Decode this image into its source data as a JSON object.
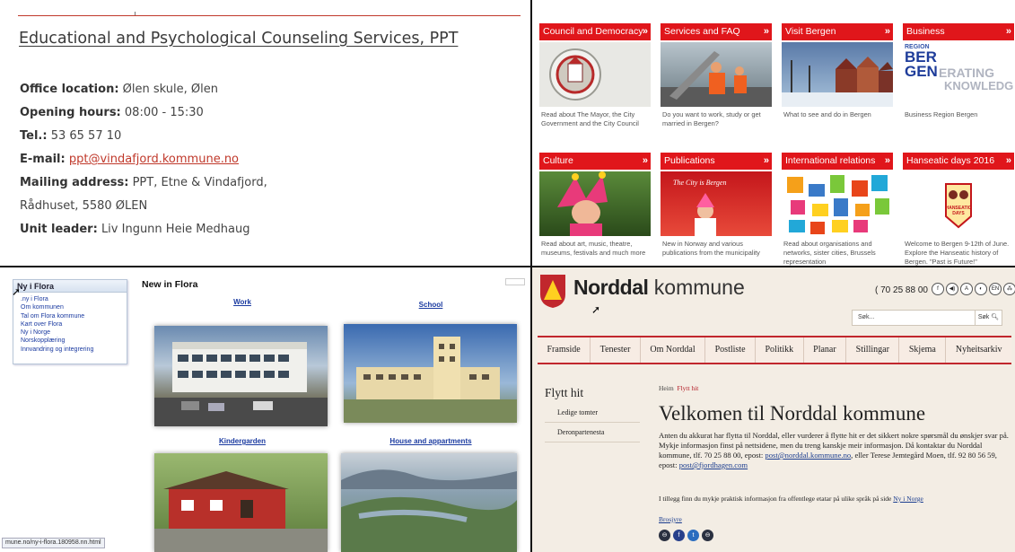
{
  "q1": {
    "title": "Educational and Psychological Counseling Services, PPT",
    "office_label": "Office location:",
    "office_value": "Ølen skule, Ølen",
    "hours_label": "Opening hours:",
    "hours_value": "08:00 - 15:30",
    "tel_label": "Tel.:",
    "tel_value": "53 65 57 10",
    "email_label": "E-mail:",
    "email_value": "ppt@vindafjord.kommune.no",
    "mail_label": "Mailing address:",
    "mail_value_1": "PPT, Etne & Vindafjord,",
    "mail_value_2": "Rådhuset, 5580 ØLEN",
    "leader_label": "Unit leader:",
    "leader_value": "Liv Ingunn Heie Medhaug",
    "accent_color": "#c0392b"
  },
  "q2": {
    "accent_color": "#e0161b",
    "tiles": [
      {
        "title": "Council and Democracy",
        "desc": "Read about The Mayor, the City Government and the City Council"
      },
      {
        "title": "Services and FAQ",
        "desc": "Do you want to work, study or get married in Bergen?"
      },
      {
        "title": "Visit Bergen",
        "desc": "What to see and do in Bergen"
      },
      {
        "title": "Business",
        "desc": "Business Region Bergen"
      },
      {
        "title": "Culture",
        "desc": "Read about art, music, theatre, museums, festivals and much more"
      },
      {
        "title": "Publications",
        "desc": "New in Norway and various publications from the municipality"
      },
      {
        "title": "International relations",
        "desc": "Read about organisations and networks, sister cities, Brussels representation"
      },
      {
        "title": "Hanseatic days 2016",
        "desc": "Welcome to Bergen 9-12th of June. Explore the Hanseatic history of Bergen. \"Past is Future!\""
      }
    ],
    "business_logo": {
      "l1": "REGION",
      "l2": "BER",
      "l3": "GEN",
      "l4": "ERATING",
      "l5": "KNOWLEDGE"
    },
    "publications_cover": "The City is Bergen",
    "hanseatic_logo": "HANSEATIC DAYS",
    "chevron": "»"
  },
  "q3": {
    "menu_title": "Ny i Flora",
    "menu_items": [
      ".ny i Flora",
      "Om kommunen",
      "Tal om Flora kommune",
      "Kart over Flora",
      "Ny i Norge",
      "Norskopplæring",
      "Innvandring og integrering"
    ],
    "page_title": "New in Flora",
    "links": [
      "Work",
      "School",
      "Kindergarden",
      "House and appartments"
    ],
    "status_url": "mune.no/ny-i-flora.180958.nn.html"
  },
  "q4": {
    "brand_bold": "Norddal",
    "brand_rest": " kommune",
    "phone": "( 70 25 88 00",
    "tools": [
      "f",
      "◀)",
      "A",
      "◐",
      "EN",
      "⁂"
    ],
    "search_placeholder": "Søk...",
    "search_button": "Søk",
    "nav": [
      "Framside",
      "Tenester",
      "Om Norddal",
      "Postliste",
      "Politikk",
      "Planar",
      "Stillingar",
      "Skjema",
      "Nyheitsarkiv"
    ],
    "side_title": "Flytt hit",
    "side_items": [
      "Ledige tomter",
      "Deronpartenesta"
    ],
    "crumb_home": "Heim",
    "crumb_current": "Flytt hit",
    "heading": "Velkomen til Norddal kommune",
    "body_text": "Anten du akkurat har flytta til Norddal, eller vurderer å flytte hit er det sikkert nokre spørsmål du ønskjer svar på. Mykje informasjon finst på nettsidene, men du treng kanskje meir informasjon. Då kontaktar du Norddal kommune, tlf. 70 25 88 00, epost:",
    "email1": "post@norddal.kommune.no",
    "body_mid": ", eller Terese Jemtegård Moen, tlf. 92 80 56 59, epost:",
    "email2": "post@fjordhagen.com",
    "extra_text": "I tillegg finn du mykje praktisk informasjon fra offentlege etatar på ulike språk på side ",
    "extra_link": "Ny i Norge",
    "brosjyre": "Brosjyre",
    "share": [
      "⊖",
      "f",
      "t",
      "⊖"
    ],
    "accent_color": "#c1272d"
  }
}
